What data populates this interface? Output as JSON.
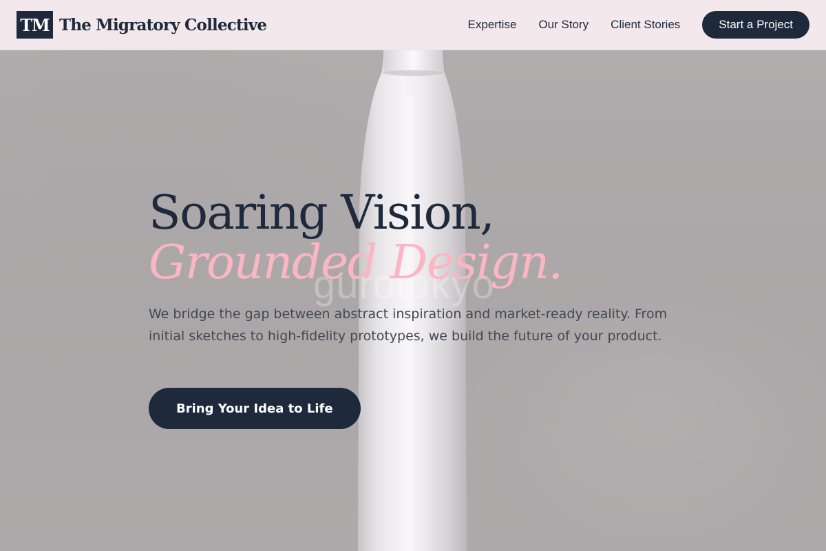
{
  "header": {
    "logo_mark": "TM",
    "brand_name": "The Migratory Collective",
    "nav": [
      {
        "label": "Expertise"
      },
      {
        "label": "Our Story"
      },
      {
        "label": "Client Stories"
      }
    ],
    "cta_label": "Start a Project"
  },
  "hero": {
    "title_line1": "Soaring Vision,",
    "title_line2": "Grounded Design.",
    "subtitle": "We bridge the gap between abstract inspiration and market-ready reality. From initial sketches to high-fidelity prototypes, we build the future of your product.",
    "cta_label": "Bring Your Idea to Life"
  },
  "background": {
    "watermark_text": "gurotokyo"
  },
  "colors": {
    "navy": "#1e293b",
    "pink": "#fbb6c3",
    "header_bg": "#f7ecef",
    "background_gray": "#aeaaab"
  }
}
